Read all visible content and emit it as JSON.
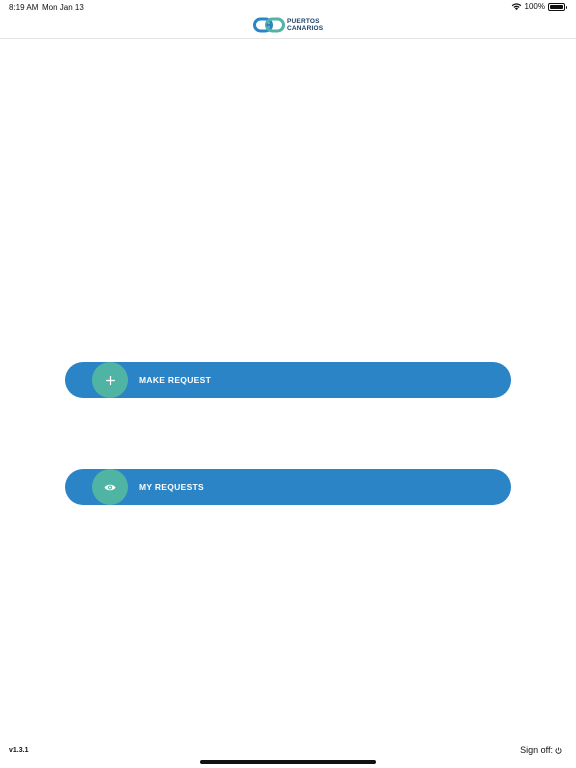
{
  "status_bar": {
    "time": "8:19 AM",
    "date": "Mon Jan 13",
    "battery": "100%",
    "battery_level": 1.0
  },
  "header": {
    "logo_line1": "PUERTOS",
    "logo_line2": "CANARIOS",
    "logo_colors": {
      "primary": "#2a84c6",
      "secondary": "#4fb4a4"
    }
  },
  "actions": {
    "make_request": {
      "label": "MAKE REQUEST",
      "icon": "plus-icon"
    },
    "my_requests": {
      "label": "MY REQUESTS",
      "icon": "eye-icon"
    }
  },
  "footer": {
    "version": "v1.3.1",
    "sign_off": "Sign off:",
    "sign_off_icon": "power-icon"
  },
  "colors": {
    "button_bg": "#2a84c6",
    "button_icon_bg": "#4fb4a4"
  }
}
